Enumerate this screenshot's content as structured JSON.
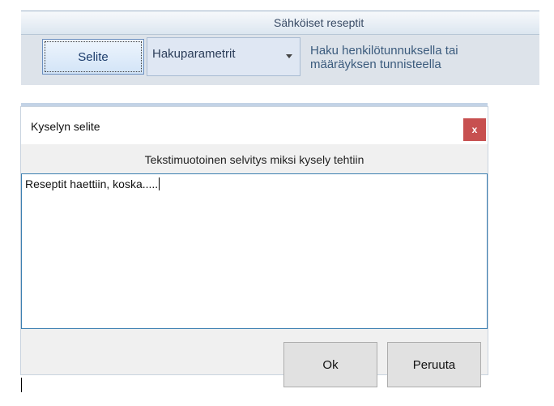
{
  "background_app": {
    "header_title": "Sähköiset reseptit",
    "selite_button_label": "Selite",
    "search_parameters_select": {
      "value": "Hakuparametrit",
      "icon": "chevron-down-icon"
    },
    "search_description": "Haku henkilötunnuksella tai määräyksen tunnisteella"
  },
  "dialog": {
    "title": "Kyselyn selite",
    "close_label": "x",
    "subtitle": "Tekstimuotoinen selvitys miksi kysely tehtiin",
    "textarea_value": "Reseptit haettiin, koska.....",
    "ok_label": "Ok",
    "cancel_label": "Peruuta"
  },
  "colors": {
    "accent_border": "#3c7fb1",
    "close_button": "#c75050",
    "app_header_text": "#3a4c66",
    "dialog_background": "#f0f0f0"
  }
}
